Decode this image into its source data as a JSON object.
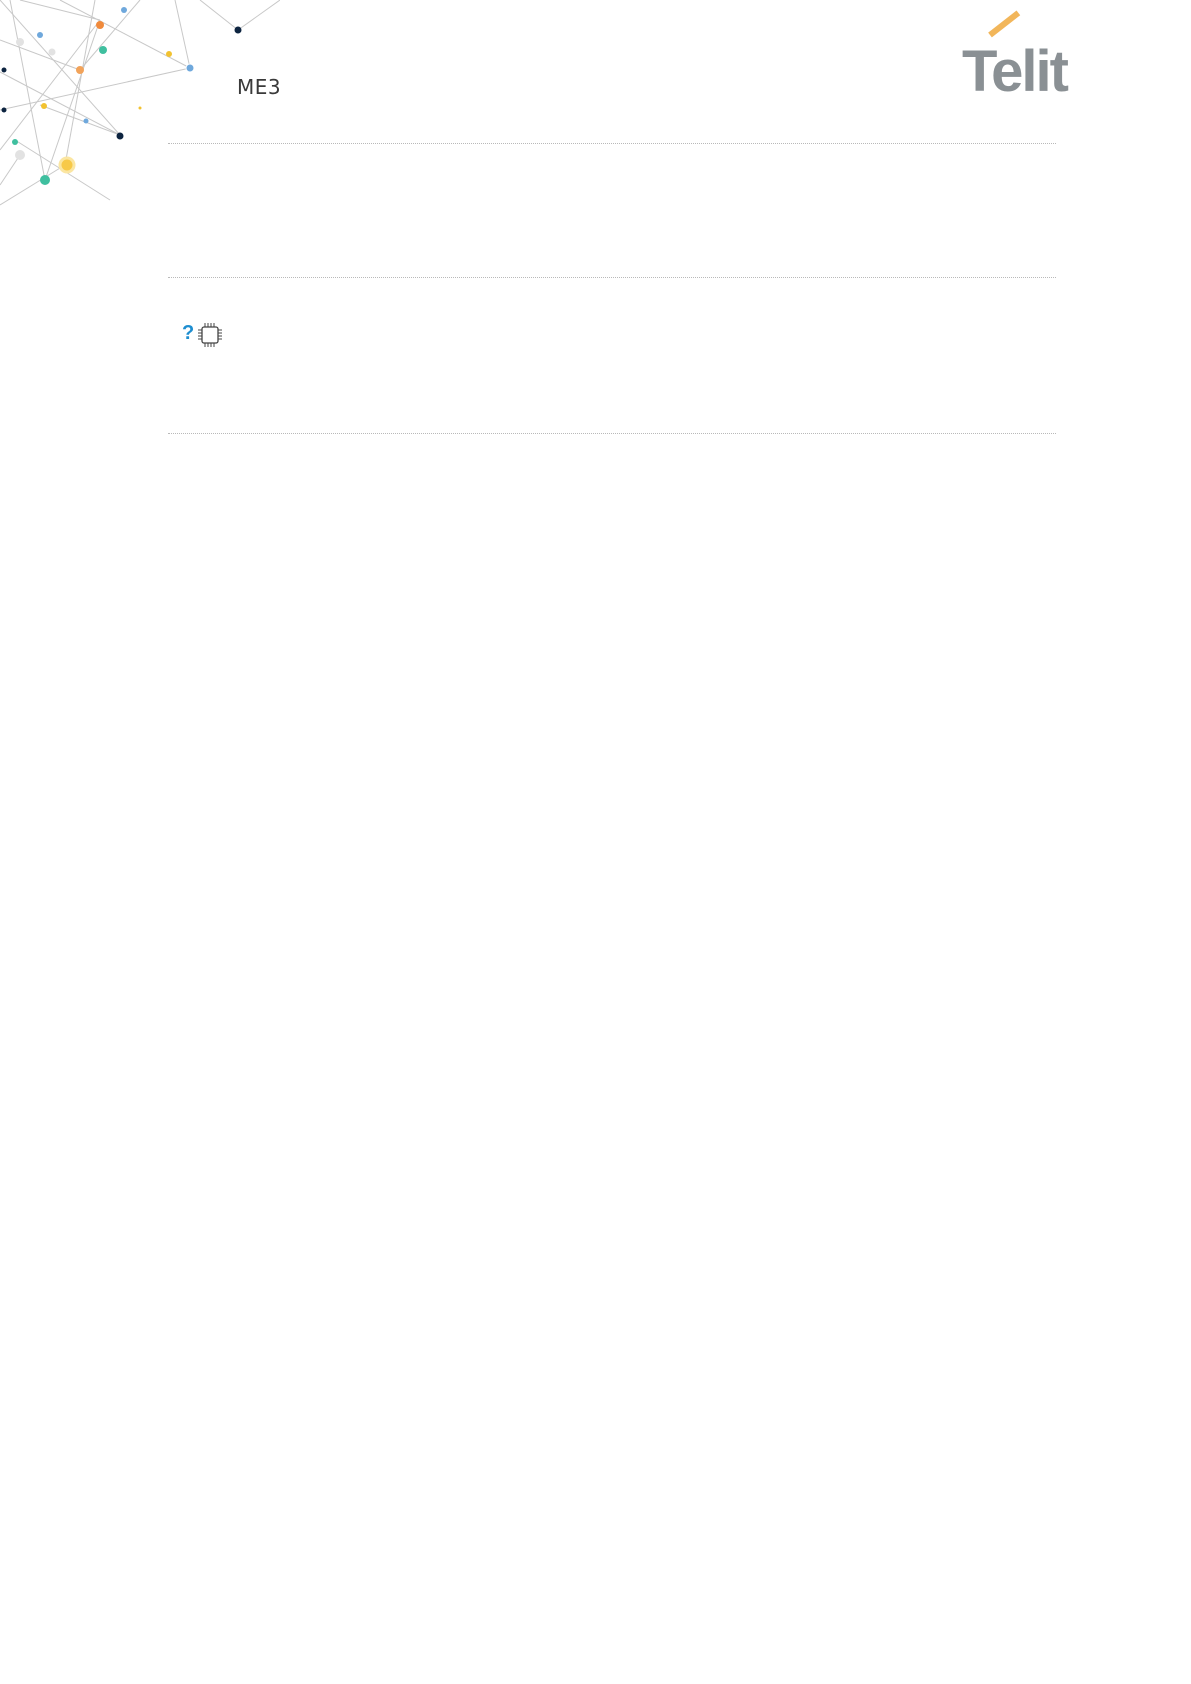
{
  "header": {
    "doc_title": "ME3",
    "logo": {
      "text": "Telit",
      "accent_color": "#f2b65a",
      "text_color": "#8a9094"
    }
  },
  "icons": {
    "help": {
      "name": "question-mark-icon",
      "glyph": "?",
      "color": "#1e8ed0"
    },
    "chip": {
      "name": "chip-icon"
    }
  }
}
